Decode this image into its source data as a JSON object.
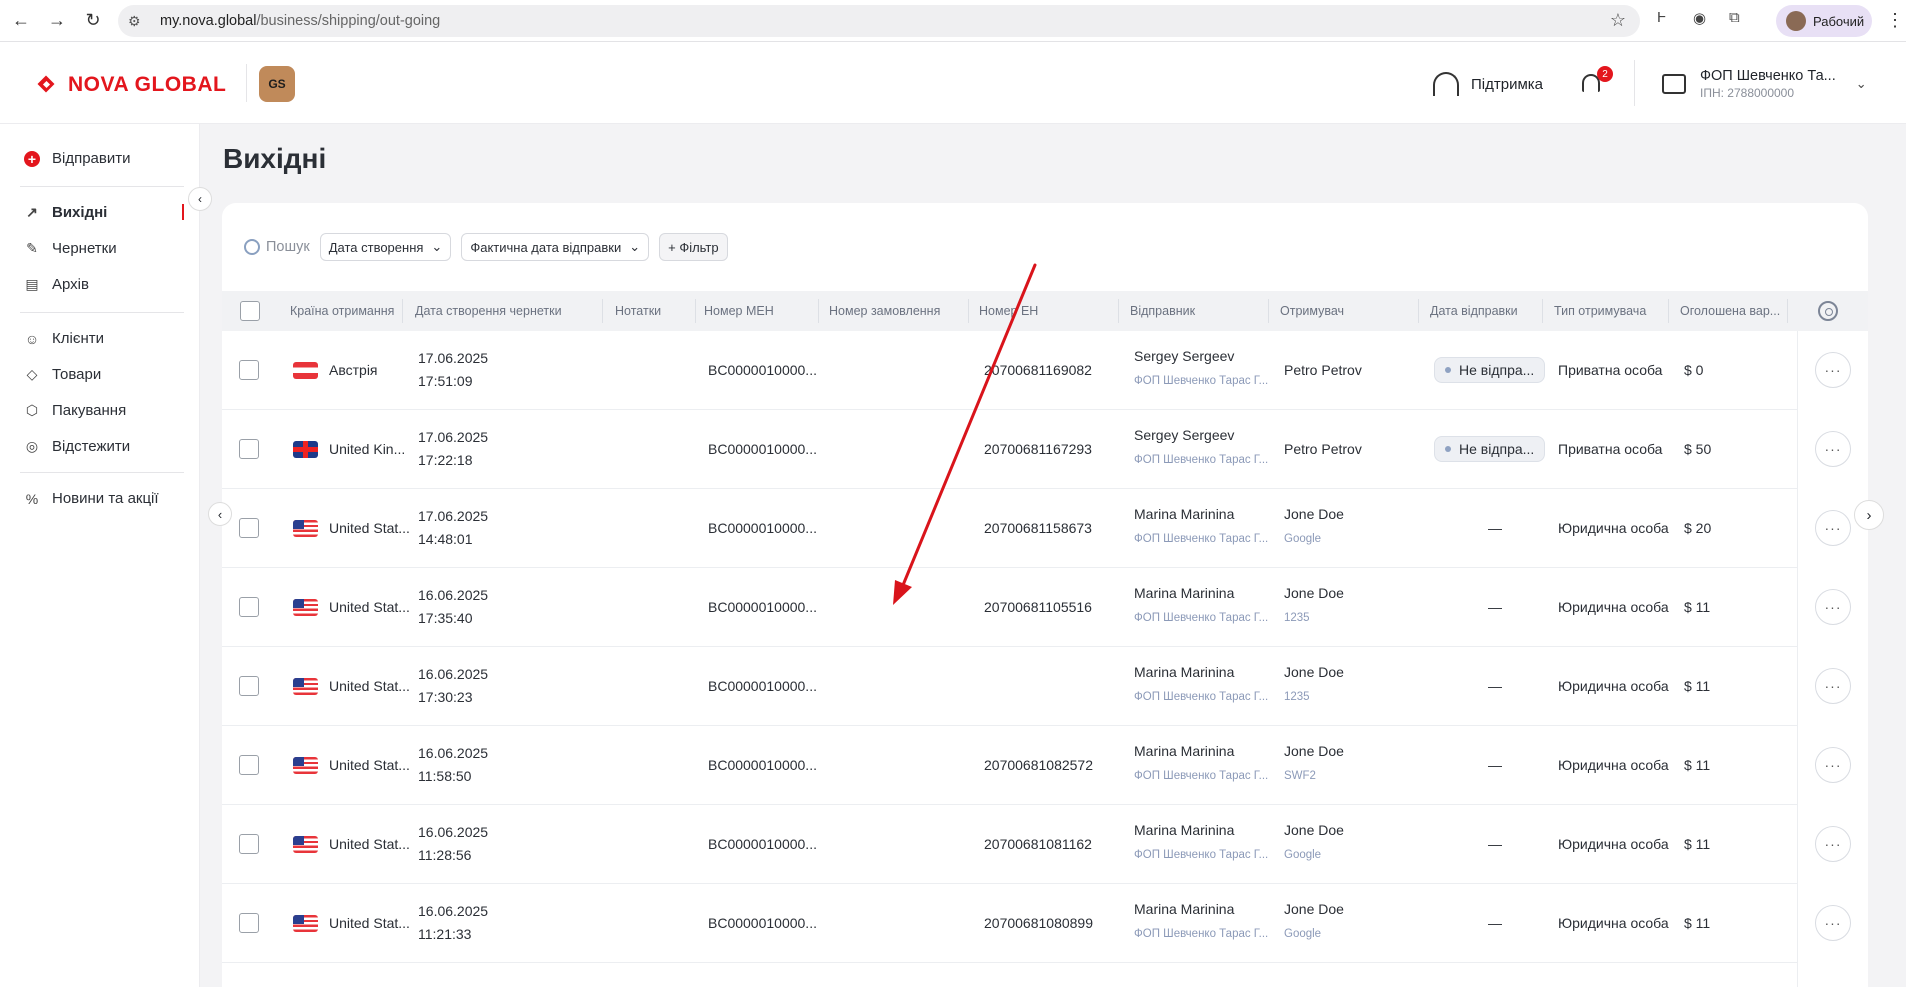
{
  "browser": {
    "url_host": "my.nova.global",
    "url_path": "/business/shipping/out-going",
    "profile_label": "Рабочий"
  },
  "header": {
    "logo_text": "NOVA GLOBAL",
    "badge": "GS",
    "support_label": "Підтримка",
    "notifications_count": "2",
    "account_name": "ФОП Шевченко Та...",
    "account_inn": "ІПН: 2788000000"
  },
  "sidebar": {
    "send_label": "Відправити",
    "items": [
      {
        "label": "Вихідні",
        "icon": "arrow-up-right-icon",
        "active": true
      },
      {
        "label": "Чернетки",
        "icon": "edit-icon"
      },
      {
        "label": "Архів",
        "icon": "archive-icon"
      },
      {
        "label": "Клієнти",
        "icon": "user-icon"
      },
      {
        "label": "Товари",
        "icon": "tag-icon"
      },
      {
        "label": "Пакування",
        "icon": "box-icon"
      },
      {
        "label": "Відстежити",
        "icon": "target-icon"
      },
      {
        "label": "Новини та акції",
        "icon": "percent-icon"
      }
    ]
  },
  "page": {
    "title": "Вихідні",
    "search_placeholder": "Пошук",
    "filter_created": "Дата створення",
    "filter_sent": "Фактична дата відправки",
    "add_filter": "+ Фільтр"
  },
  "table": {
    "columns": [
      "Країна отримання",
      "Дата створення чернетки",
      "Нотатки",
      "Номер МЕН",
      "Номер замовлення",
      "Номер ЕН",
      "Відправник",
      "Отримувач",
      "Дата відправки",
      "Тип отримувача",
      "Оголошена вар..."
    ],
    "rows": [
      {
        "flag": "at",
        "country": "Австрія",
        "date": "17.06.2025",
        "time": "17:51:09",
        "men": "BC0000010000...",
        "en": "20700681169082",
        "sender": "Sergey Sergeev",
        "sender_sub": "ФОП Шевченко Тарас Г...",
        "recipient": "Petro Petrov",
        "recipient_sub": "",
        "ship_date": "Не відпра...",
        "ship_status": true,
        "type": "Приватна особа",
        "value": "$ 0"
      },
      {
        "flag": "gb",
        "country": "United Kin...",
        "date": "17.06.2025",
        "time": "17:22:18",
        "men": "BC0000010000...",
        "en": "20700681167293",
        "sender": "Sergey Sergeev",
        "sender_sub": "ФОП Шевченко Тарас Г...",
        "recipient": "Petro Petrov",
        "recipient_sub": "",
        "ship_date": "Не відпра...",
        "ship_status": true,
        "type": "Приватна особа",
        "value": "$ 50"
      },
      {
        "flag": "us",
        "country": "United Stat...",
        "date": "17.06.2025",
        "time": "14:48:01",
        "men": "BC0000010000...",
        "en": "20700681158673",
        "sender": "Marina Marinina",
        "sender_sub": "ФОП Шевченко Тарас Г...",
        "recipient": "Jone Doe",
        "recipient_sub": "Google",
        "ship_date": "—",
        "ship_status": false,
        "type": "Юридична особа",
        "value": "$ 20"
      },
      {
        "flag": "us",
        "country": "United Stat...",
        "date": "16.06.2025",
        "time": "17:35:40",
        "men": "BC0000010000...",
        "en": "20700681105516",
        "sender": "Marina Marinina",
        "sender_sub": "ФОП Шевченко Тарас Г...",
        "recipient": "Jone Doe",
        "recipient_sub": "1235",
        "ship_date": "—",
        "ship_status": false,
        "type": "Юридична особа",
        "value": "$ 11"
      },
      {
        "flag": "us",
        "country": "United Stat...",
        "date": "16.06.2025",
        "time": "17:30:23",
        "men": "BC0000010000...",
        "en": "",
        "sender": "Marina Marinina",
        "sender_sub": "ФОП Шевченко Тарас Г...",
        "recipient": "Jone Doe",
        "recipient_sub": "1235",
        "ship_date": "—",
        "ship_status": false,
        "type": "Юридична особа",
        "value": "$ 11"
      },
      {
        "flag": "us",
        "country": "United Stat...",
        "date": "16.06.2025",
        "time": "11:58:50",
        "men": "BC0000010000...",
        "en": "20700681082572",
        "sender": "Marina Marinina",
        "sender_sub": "ФОП Шевченко Тарас Г...",
        "recipient": "Jone Doe",
        "recipient_sub": "SWF2",
        "ship_date": "—",
        "ship_status": false,
        "type": "Юридична особа",
        "value": "$ 11"
      },
      {
        "flag": "us",
        "country": "United Stat...",
        "date": "16.06.2025",
        "time": "11:28:56",
        "men": "BC0000010000...",
        "en": "20700681081162",
        "sender": "Marina Marinina",
        "sender_sub": "ФОП Шевченко Тарас Г...",
        "recipient": "Jone Doe",
        "recipient_sub": "Google",
        "ship_date": "—",
        "ship_status": false,
        "type": "Юридична особа",
        "value": "$ 11"
      },
      {
        "flag": "us",
        "country": "United Stat...",
        "date": "16.06.2025",
        "time": "11:21:33",
        "men": "BC0000010000...",
        "en": "20700681080899",
        "sender": "Marina Marinina",
        "sender_sub": "ФОП Шевченко Тарас Г...",
        "recipient": "Jone Doe",
        "recipient_sub": "Google",
        "ship_date": "—",
        "ship_status": false,
        "type": "Юридична особа",
        "value": "$ 11"
      }
    ]
  },
  "colors": {
    "brand": "#e3161d",
    "annotation_arrow": "#d9141b"
  }
}
